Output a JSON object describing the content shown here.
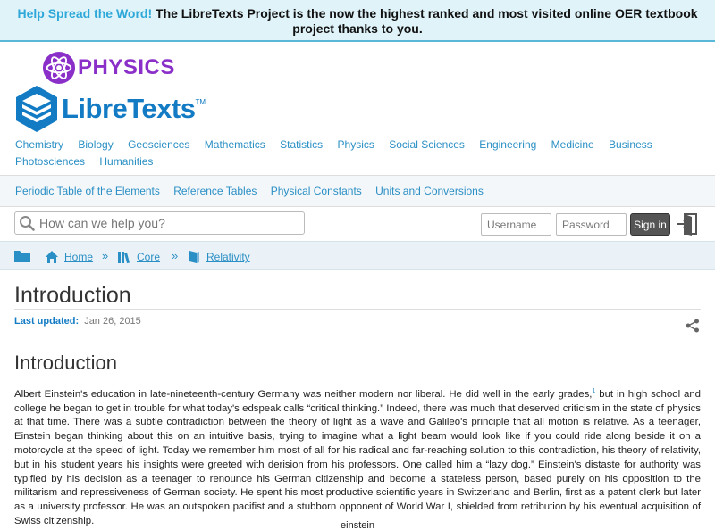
{
  "banner": {
    "highlight": "Help Spread the Word!",
    "message": "The LibreTexts Project is the now the highest ranked and most visited online OER textbook project thanks to you."
  },
  "logos": {
    "library": "PHYSICS",
    "brand": "LibreTexts",
    "brand_tm": "TM"
  },
  "subjects": [
    "Chemistry",
    "Biology",
    "Geosciences",
    "Mathematics",
    "Statistics",
    "Physics",
    "Social Sciences",
    "Engineering",
    "Medicine",
    "Business",
    "Photosciences",
    "Humanities"
  ],
  "reference_links": [
    "Periodic Table of the Elements",
    "Reference Tables",
    "Physical Constants",
    "Units and Conversions"
  ],
  "search": {
    "placeholder": "How can we help you?"
  },
  "login": {
    "username_placeholder": "Username",
    "password_placeholder": "Password",
    "signin_label": "Sign in"
  },
  "breadcrumb": {
    "items": [
      "Home",
      "Core",
      "Relativity"
    ],
    "separator": "»"
  },
  "page": {
    "title": "Introduction",
    "last_updated_label": "Last updated:",
    "last_updated_date": "Jan 26, 2015",
    "heading": "Introduction",
    "body_part1": "Albert Einstein's education in late-nineteenth-century Germany was neither modern nor liberal. He did well in the early grades,",
    "footnote": "1",
    "body_part2": " but in high school and college he began to get in trouble for what today's edspeak calls “critical thinking.” Indeed, there was much that deserved criticism in the state of physics at that time. There was a subtle contradiction between the theory of light as a wave and Galileo's principle that all motion is relative. As a teenager, Einstein began thinking about this on an intuitive basis, trying to imagine what a light beam would look like if you could ride along beside it on a motorcycle at the speed of light. Today we remember him most of all for his radical and far-reaching solution to this contradiction, his theory of relativity, but in his student years his insights were greeted with derision from his professors. One called him a “lazy dog.” Einstein's distaste for authority was typified by his decision as a teenager to renounce his German citizenship and become a stateless person, based purely on his opposition to the militarism and repressiveness of German society. He spent his most productive scientific years in Switzerland and Berlin, first as a patent clerk but later as a university professor. He was an outspoken pacifist and a stubborn opponent of World War I, shielded from retribution by his eventual acquisition of Swiss citizenship.",
    "image_caption": "einstein"
  },
  "colors": {
    "banner_bg": "#dff3f9",
    "link": "#2a8fc4",
    "brand_blue": "#127bc4",
    "physics_purple": "#8b2fc9"
  },
  "icons": [
    "atom-icon",
    "libretexts-books-icon",
    "search-icon",
    "signin-icon",
    "folder-icon",
    "home-icon",
    "books-icon",
    "book-icon",
    "share-icon"
  ]
}
